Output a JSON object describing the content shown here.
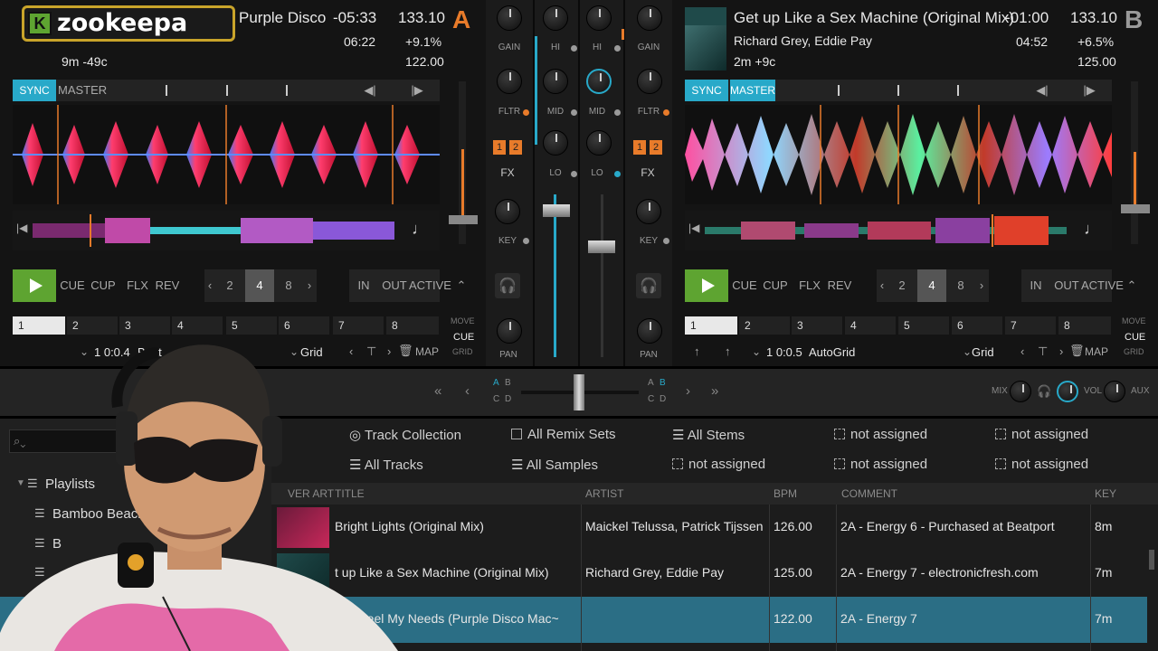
{
  "logo": {
    "text": "zookeepa",
    "mark": "K"
  },
  "colors": {
    "accent": "#28a9c9",
    "deck_a": "#e87b2a",
    "play": "#5ea431",
    "selected_row": "#2b6e85"
  },
  "deck_a": {
    "letter": "A",
    "title": "Purple Disco",
    "remaining": "-05:33",
    "elapsed": "06:22",
    "bpm": "133.10",
    "pitch": "+9.1%",
    "original_bpm": "122.00",
    "key_info": "9m -49c",
    "sync_label": "SYNC",
    "master_label": "MASTER",
    "transport": {
      "play": "play",
      "cue": "CUE",
      "cup": "CUP",
      "flx": "FLX",
      "rev": "REV"
    },
    "loop_sizes": [
      "2",
      "4",
      "8"
    ],
    "loop_active": "4",
    "loop_buttons": {
      "in": "IN",
      "out": "OUT",
      "active": "ACTIVE"
    },
    "cue_slots": [
      "1",
      "2",
      "3",
      "4",
      "5",
      "6",
      "7",
      "8"
    ],
    "grid_mode": [
      "MOVE",
      "CUE",
      "GRID"
    ],
    "cue_position": "1 0:0.4",
    "cue_type": "Beat",
    "grid_label": "Grid",
    "map_label": "MAP"
  },
  "deck_b": {
    "letter": "B",
    "title": "Get up Like a Sex Machine (Original Mix)",
    "artist": "Richard Grey, Eddie Pay",
    "remaining": "-01:00",
    "elapsed": "04:52",
    "bpm": "133.10",
    "pitch": "+6.5%",
    "original_bpm": "125.00",
    "key_info": "2m +9c",
    "sync_label": "SYNC",
    "master_label": "MASTER",
    "transport": {
      "play": "play",
      "cue": "CUE",
      "cup": "CUP",
      "flx": "FLX",
      "rev": "REV"
    },
    "loop_sizes": [
      "2",
      "4",
      "8"
    ],
    "loop_active": "4",
    "loop_buttons": {
      "in": "IN",
      "out": "OUT",
      "active": "ACTIVE"
    },
    "cue_slots": [
      "1",
      "2",
      "3",
      "4",
      "5",
      "6",
      "7",
      "8"
    ],
    "grid_mode": [
      "MOVE",
      "CUE",
      "GRID"
    ],
    "cue_position": "1 0:0.5",
    "cue_type": "AutoGrid",
    "grid_label": "Grid",
    "map_label": "MAP"
  },
  "mixer": {
    "gain": "GAIN",
    "hi": "HI",
    "mid": "MID",
    "lo": "LO",
    "fltr": "FLTR",
    "fx": "FX",
    "key": "KEY",
    "pan": "PAN",
    "fx_units": [
      "1",
      "2"
    ]
  },
  "crossfader": {
    "left_top": [
      "A",
      "B"
    ],
    "left_bottom": [
      "C",
      "D"
    ],
    "right_top": [
      "A",
      "B"
    ],
    "right_bottom": [
      "C",
      "D"
    ]
  },
  "master_section": {
    "mix": "MIX",
    "vol": "VOL",
    "aux": "AUX"
  },
  "browser": {
    "favorites_row1": [
      "Track Collection",
      "All Remix Sets",
      "All Stems",
      "not assigned",
      "not assigned"
    ],
    "favorites_row2": [
      "All Tracks",
      "All Samples",
      "not assigned",
      "not assigned",
      "not assigned"
    ],
    "tree": {
      "playlists": "Playlists",
      "items": [
        "Bamboo Beach",
        "B",
        ""
      ]
    },
    "columns": {
      "cover": "VER ART",
      "title": "TITLE",
      "artist": "ARTIST",
      "bpm": "BPM",
      "comment": "COMMENT",
      "key": "KEY"
    },
    "rows": [
      {
        "title": "Bright Lights (Original Mix)",
        "artist": "Maickel Telussa, Patrick Tijssen",
        "bpm": "126.00",
        "comment": "2A - Energy 6 - Purchased at Beatport",
        "key": "8m"
      },
      {
        "title": "t up Like a Sex Machine (Original Mix)",
        "artist": "Richard Grey, Eddie Pay",
        "bpm": "125.00",
        "comment": "2A - Energy 7 - electronicfresh.com",
        "key": "7m"
      },
      {
        "title": ") - Feel My Needs (Purple Disco Mac~",
        "artist": "",
        "bpm": "122.00",
        "comment": "2A - Energy 7",
        "key": "7m"
      }
    ]
  }
}
